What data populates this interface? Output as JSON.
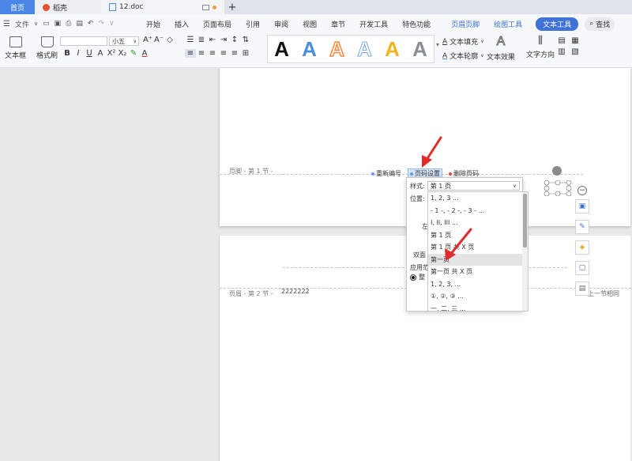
{
  "tabs": [
    {
      "label": "首页"
    },
    {
      "label": "稻壳"
    },
    {
      "label": "12.doc"
    }
  ],
  "menu": {
    "file": "文件",
    "items": [
      "开始",
      "插入",
      "页面布局",
      "引用",
      "审阅",
      "视图",
      "章节",
      "开发工具",
      "特色功能"
    ],
    "context": [
      "页眉页脚",
      "绘图工具"
    ],
    "active": "文本工具",
    "search": "查找"
  },
  "ribbon": {
    "textbox": "文本框",
    "format_painter": "格式刷",
    "font_size": "小五",
    "bold": "B",
    "italic": "I",
    "underline": "U",
    "gallery_letter": "A",
    "text_fill": "文本填充",
    "text_outline": "文本轮廓",
    "text_effect": "文本效果",
    "text_direction": "文字方向"
  },
  "doc": {
    "footer1_label": "页脚 - 第 1 节 -",
    "footer2_label": "页眉 - 第 2 节 -",
    "footer2_text": "2222222",
    "same_as_prev": "上一节相同",
    "toolbar": {
      "renumber": "重新编号",
      "page_number_settings": "页码设置",
      "delete_page_number": "删除页码"
    }
  },
  "panel": {
    "style_label": "样式:",
    "style_value": "第 1 页",
    "position_label": "位置:",
    "left_label": "左",
    "double_label": "双面",
    "apply_label": "应用范",
    "whole_label": "整",
    "options": [
      "1, 2, 3 ...",
      "- 1 -, - 2 -, - 3 - ...",
      "I, II, III ...",
      "第 1 页",
      "第 1 页 共 X 页",
      "第一页",
      "第一页 共 X 页",
      "1, 2, 3, ...",
      "①, ②, ③ ...",
      "一, 二, 三 ..."
    ]
  },
  "colors": {
    "accent": "#3f73d8",
    "arrow": "#e02b2b"
  }
}
